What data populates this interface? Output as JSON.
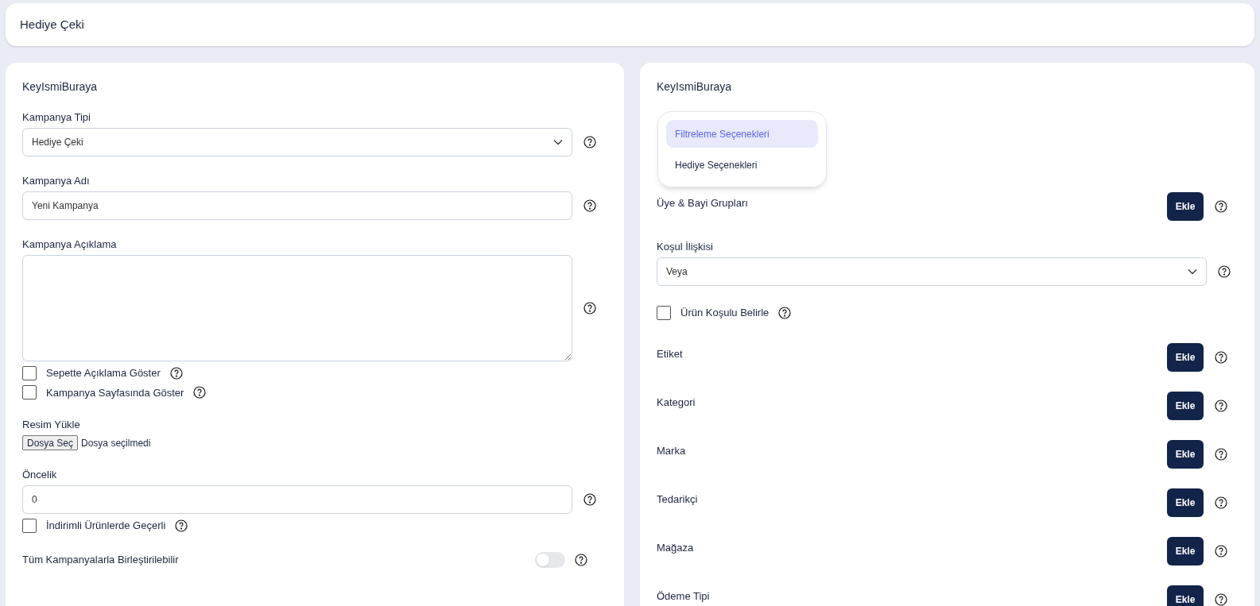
{
  "header": {
    "title": "Hediye Çeki"
  },
  "left_panel": {
    "title": "KeyIsmiBuraya",
    "fields": [
      {
        "kind": "select",
        "label": "Kampanya Tipi",
        "value": "Hediye Çeki"
      },
      {
        "kind": "input",
        "label": "Kampanya Adı",
        "value": "Yeni Kampanya"
      },
      {
        "kind": "textarea",
        "label": "Kampanya Açıklama"
      },
      {
        "kind": "checkbox",
        "label": "Sepette Açıklama Göster",
        "checked": false
      },
      {
        "kind": "checkbox",
        "label": "Kampanya Sayfasında Göster",
        "checked": false
      },
      {
        "kind": "file",
        "label": "Resim Yükle",
        "button": "Dosya Seç",
        "status": "Dosya seçilmedi"
      },
      {
        "kind": "input",
        "label": "Öncelik",
        "value": "0"
      },
      {
        "kind": "checkbox",
        "label": "İndirimli Ürünlerde Geçerli",
        "checked": false
      },
      {
        "kind": "toggle",
        "label": "Tüm Kampanyalarla Birleştirilebilir",
        "on": false
      }
    ]
  },
  "right_panel": {
    "title": "KeyIsmiBuraya",
    "tabs": [
      {
        "label": "Filtreleme Seçenekleri",
        "selected": true
      },
      {
        "label": "Hediye Seçenekleri",
        "selected": false
      }
    ],
    "fields": [
      {
        "kind": "add",
        "label": "Üye & Bayi Grupları",
        "button": "Ekle"
      },
      {
        "kind": "select",
        "label": "Koşul İlişkisi",
        "value": "Veya"
      },
      {
        "kind": "checkbox",
        "label": "Ürün Koşulu Belirle",
        "checked": false
      },
      {
        "kind": "add",
        "label": "Etiket",
        "button": "Ekle"
      },
      {
        "kind": "add",
        "label": "Kategori",
        "button": "Ekle"
      },
      {
        "kind": "add",
        "label": "Marka",
        "button": "Ekle"
      },
      {
        "kind": "add",
        "label": "Tedarikçi",
        "button": "Ekle"
      },
      {
        "kind": "add",
        "label": "Mağaza",
        "button": "Ekle"
      },
      {
        "kind": "add",
        "label": "Ödeme Tipi",
        "button": "Ekle"
      }
    ]
  }
}
